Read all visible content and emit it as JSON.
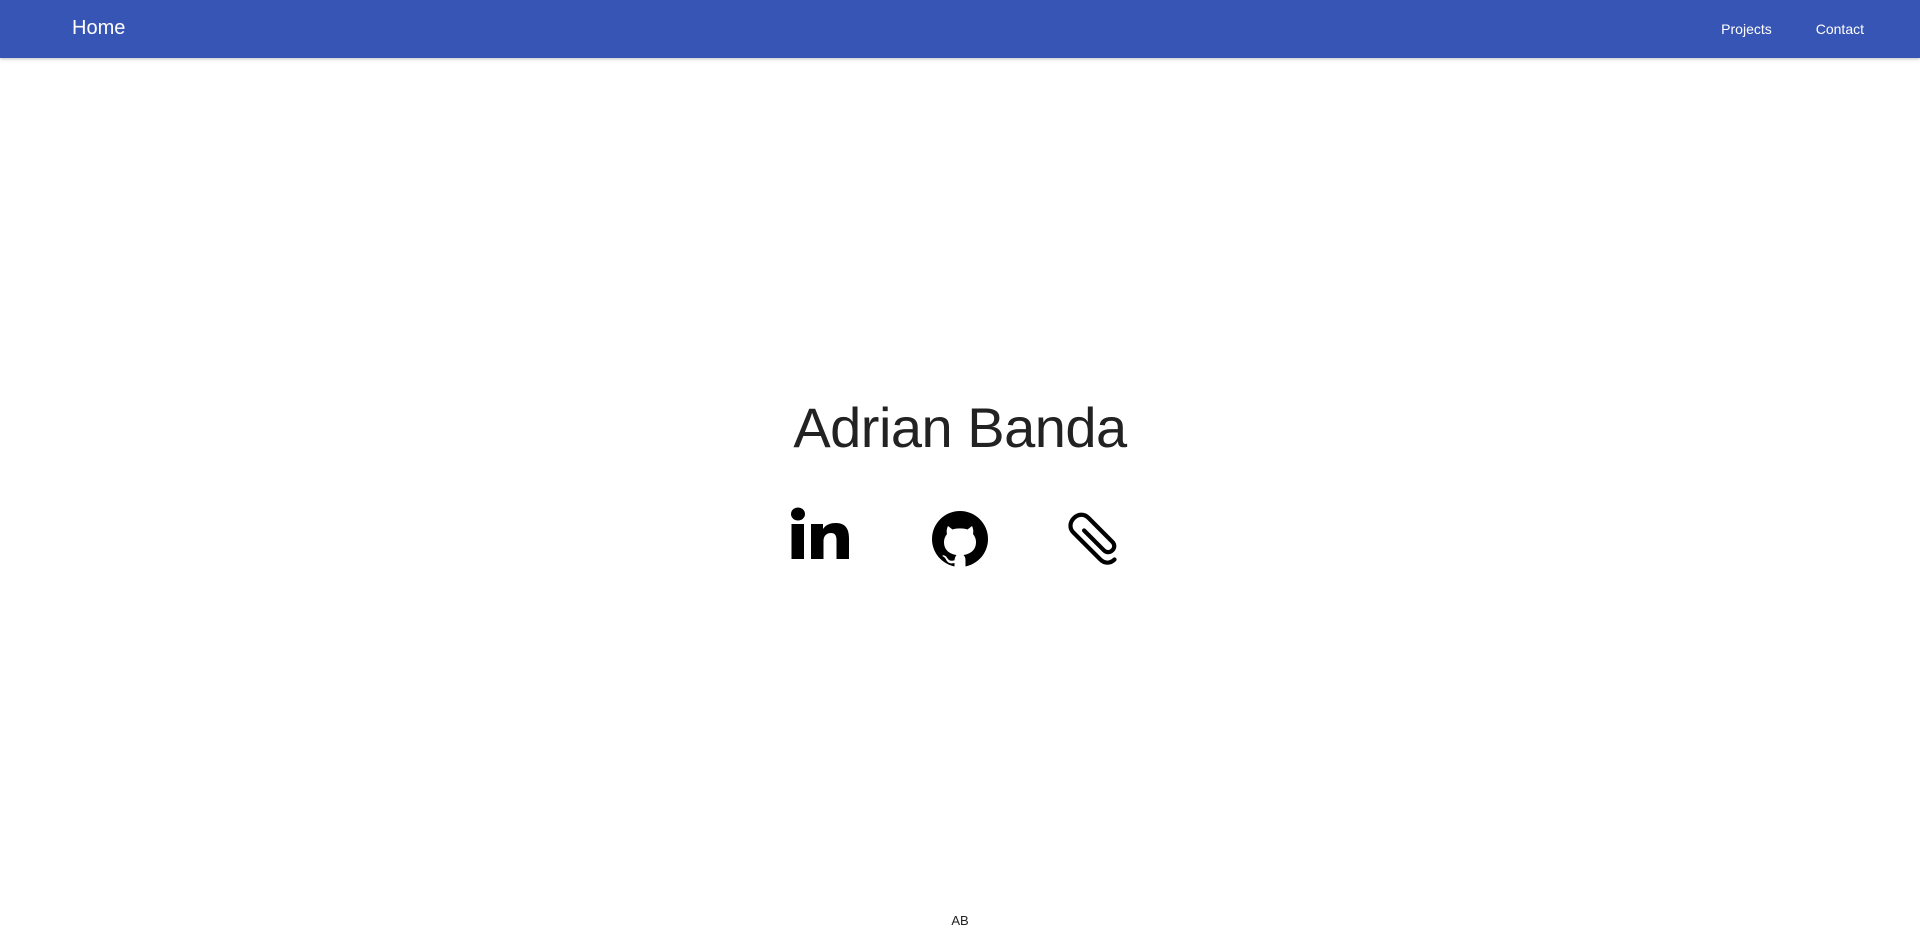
{
  "nav": {
    "brand": "Home",
    "links": [
      {
        "label": "Projects"
      },
      {
        "label": "Contact"
      }
    ]
  },
  "hero": {
    "name": "Adrian Banda"
  },
  "social": {
    "icons": [
      "linkedin-icon",
      "github-icon",
      "paperclip-icon"
    ]
  },
  "footer": {
    "initials": "AB"
  },
  "colors": {
    "navbar": "#3755b4",
    "text": "#222222",
    "icon": "#000000"
  }
}
